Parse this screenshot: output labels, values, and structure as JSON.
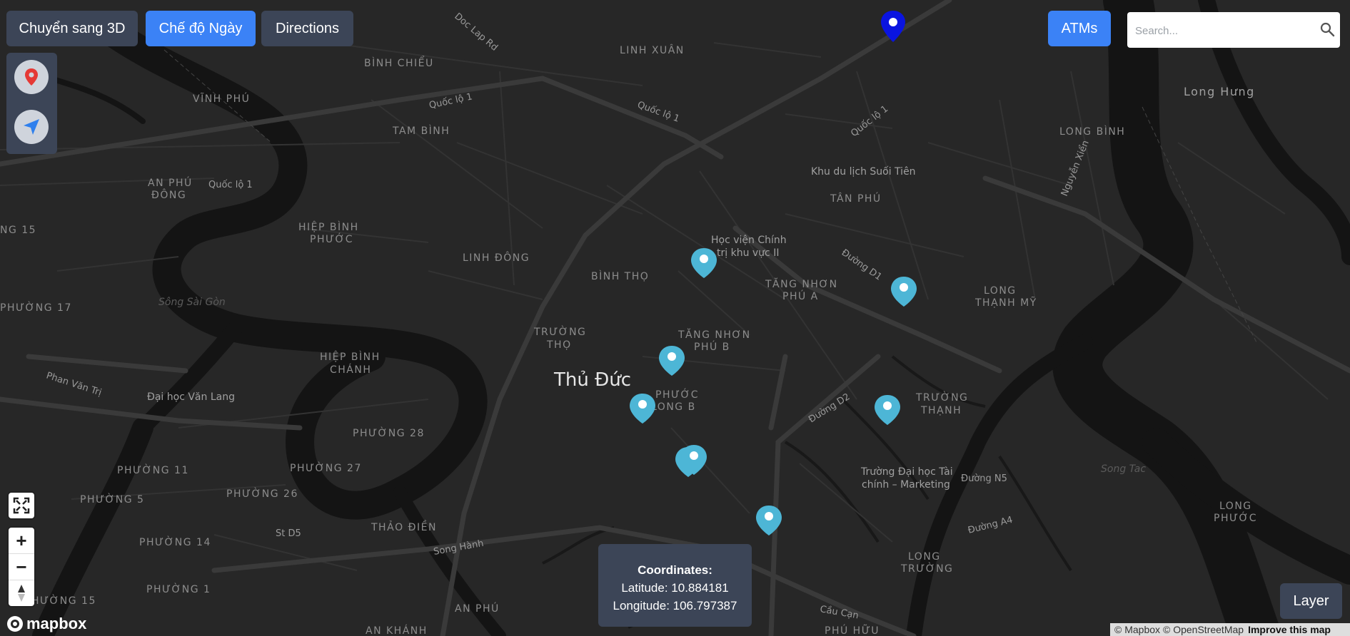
{
  "toolbar": {
    "toggle_3d": "Chuyển sang 3D",
    "day_mode": "Chế độ Ngày",
    "directions": "Directions",
    "atms": "ATMs",
    "search_placeholder": "Search..."
  },
  "side_panel": {
    "icons": [
      "map-pin-icon",
      "navigation-arrow-icon"
    ]
  },
  "map_controls": {
    "fullscreen_icon": "fullscreen-icon",
    "zoom_in": "+",
    "zoom_out": "−",
    "compass_icon": "compass-icon"
  },
  "coordinates": {
    "title": "Coordinates:",
    "latitude": "Latitude: 10.884181",
    "longitude": "Longitude: 106.797387"
  },
  "attribution": {
    "mapbox": "© Mapbox",
    "osm": "© OpenStreetMap",
    "improve": "Improve this map"
  },
  "logo": "mapbox",
  "layer_button": "Layer",
  "colors": {
    "map_background": "#262626",
    "button_dark": "#3c4557",
    "button_blue": "#3b82f6",
    "marker_atm": "#4db6d6",
    "marker_user": "#0a14e0"
  },
  "map_labels": {
    "city": "Thủ Đức",
    "districts": {
      "binh_chieu": "BÌNH CHIỂU",
      "linh_xuan": "LINH XUÂN",
      "vinh_phu": "VĨNH PHÚ",
      "tam_binh": "TAM BÌNH",
      "an_phu_dong_1": "AN PHÚ",
      "an_phu_dong_2": "ĐÔNG",
      "hiep_binh_phuoc_1": "HIỆP BÌNH",
      "hiep_binh_phuoc_2": "PHƯỚC",
      "linh_dong": "LINH ĐÔNG",
      "binh_tho": "BÌNH THỌ",
      "tan_phu": "TÂN PHÚ",
      "tang_nhon_phu_a_1": "TĂNG NHƠN",
      "tang_nhon_phu_a_2": "PHÚ A",
      "tang_nhon_phu_b_1": "TĂNG NHƠN",
      "tang_nhon_phu_b_2": "PHÚ B",
      "truong_tho_1": "TRƯỜNG",
      "truong_tho_2": "THỌ",
      "hiep_binh_chanh_1": "HIỆP BÌNH",
      "hiep_binh_chanh_2": "CHÁNH",
      "phuoc_long_b_1": "PHƯỚC",
      "phuoc_long_b_2": "LONG B",
      "phuong_28": "PHƯỜNG 28",
      "phuong_27": "PHƯỜNG 27",
      "phuong_26": "PHƯỜNG 26",
      "phuong_11": "PHƯỜNG 11",
      "phuong_5": "PHƯỜNG 5",
      "phuong_14": "PHƯỜNG 14",
      "phuong_1": "PHƯỜNG 1",
      "phuong_15": "PHƯỜNG 15",
      "phuong_17": "PHƯỜNG 17",
      "ng_15": "NG 15",
      "thao_dien": "THẢO ĐIỀN",
      "an_phu": "AN PHÚ",
      "an_khanh": "AN KHÁNH",
      "phu_huu": "PHÚ HỮU",
      "long_binh": "LONG BÌNH",
      "long_thanh_my_1": "LONG",
      "long_thanh_my_2": "THẠNH MỸ",
      "truong_thanh_1": "TRƯỜNG",
      "truong_thanh_2": "THẠNH",
      "long_truong_1": "LONG",
      "long_truong_2": "TRƯỜNG",
      "long_phuoc_1": "LONG",
      "long_phuoc_2": "PHƯỚC",
      "long_hung": "Long Hưng"
    },
    "roads": {
      "doc_lap": "Doc Lap Rd",
      "quoc_lo_1a": "Quốc lộ 1",
      "quoc_lo_1b": "Quốc lộ 1",
      "quoc_lo_1c": "Quốc lộ 1",
      "quoc_lo_1d": "Quốc lộ 1",
      "duong_d1": "Đường D1",
      "duong_d2": "Đường D2",
      "duong_n5": "Đường N5",
      "duong_a4": "Đường A4",
      "nguyen_xien": "Nguyễn Xiển",
      "phan_van_tri": "Phan Văn Trị",
      "song_hanh": "Song Hành",
      "st_d5": "St D5",
      "cau_can": "Cầu Cạn"
    },
    "places": {
      "suoi_tien": "Khu du lịch Suối Tiên",
      "hoc_vien_1": "Học viện Chính",
      "hoc_vien_2": "trị khu vực II",
      "dh_van_lang": "Đại học Văn Lang",
      "tc_marketing_1": "Trường Đại học Tài",
      "tc_marketing_2": "chính – Marketing",
      "song_sai_gon": "Sông Sài Gòn",
      "song_tac": "Song Tac"
    }
  }
}
